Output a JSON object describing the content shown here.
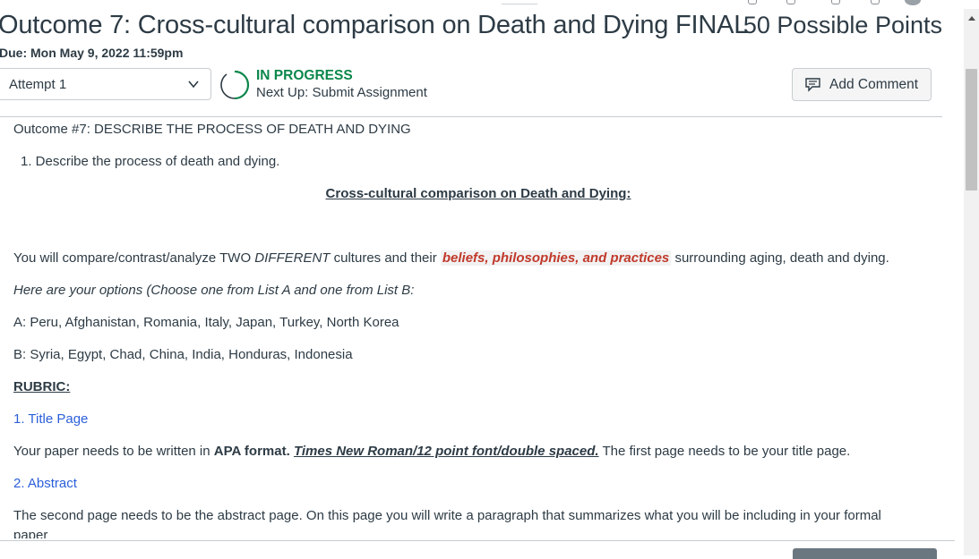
{
  "header": {
    "title": "Outcome 7: Cross-cultural comparison on Death and Dying FINAL",
    "points": "50 Possible Points",
    "due_label": "Due:",
    "due_value": "Mon May 9, 2022 11:59pm"
  },
  "attempt": {
    "selected": "Attempt 1"
  },
  "status": {
    "state": "IN PROGRESS",
    "next": "Next Up: Submit Assignment",
    "color": "#0b874b"
  },
  "actions": {
    "add_comment": "Add Comment"
  },
  "content": {
    "outcome": "Outcome #7: DESCRIBE THE PROCESS OF DEATH AND DYING",
    "item1": "1. Describe the process of death and dying.",
    "heading": "Cross-cultural comparison on Death and Dying:",
    "compare_a": "You will compare/contrast/analyze TWO ",
    "compare_b": "DIFFERENT",
    "compare_c": " cultures and their ",
    "compare_hl": "beliefs, philosophies, and practices",
    "compare_d": " surrounding aging, death and dying.",
    "options": "Here are your options (Choose one from List A and one from List B:",
    "list_a": "A: Peru, Afghanistan, Romania, Italy, Japan, Turkey, North Korea",
    "list_b": "B: Syria, Egypt, Chad, China, India, Honduras, Indonesia",
    "rubric": "RUBRIC:",
    "title_page": "1. Title Page",
    "tp_a": "Your paper needs to be written in ",
    "tp_b": "APA format.",
    "tp_c": " ",
    "tp_d": "Times New Roman/12 point font/double spaced.",
    "tp_e": " The first page needs to be your title page.",
    "abstract": "2. Abstract",
    "abs_text": "The second page needs to be the abstract page.  On this page you will write a paragraph that summarizes what you will be including in your formal",
    "abs_cut": "paper"
  },
  "colors": {
    "link": "#2b5fd9",
    "highlight": "#c0392b",
    "text": "#2d3b45"
  }
}
